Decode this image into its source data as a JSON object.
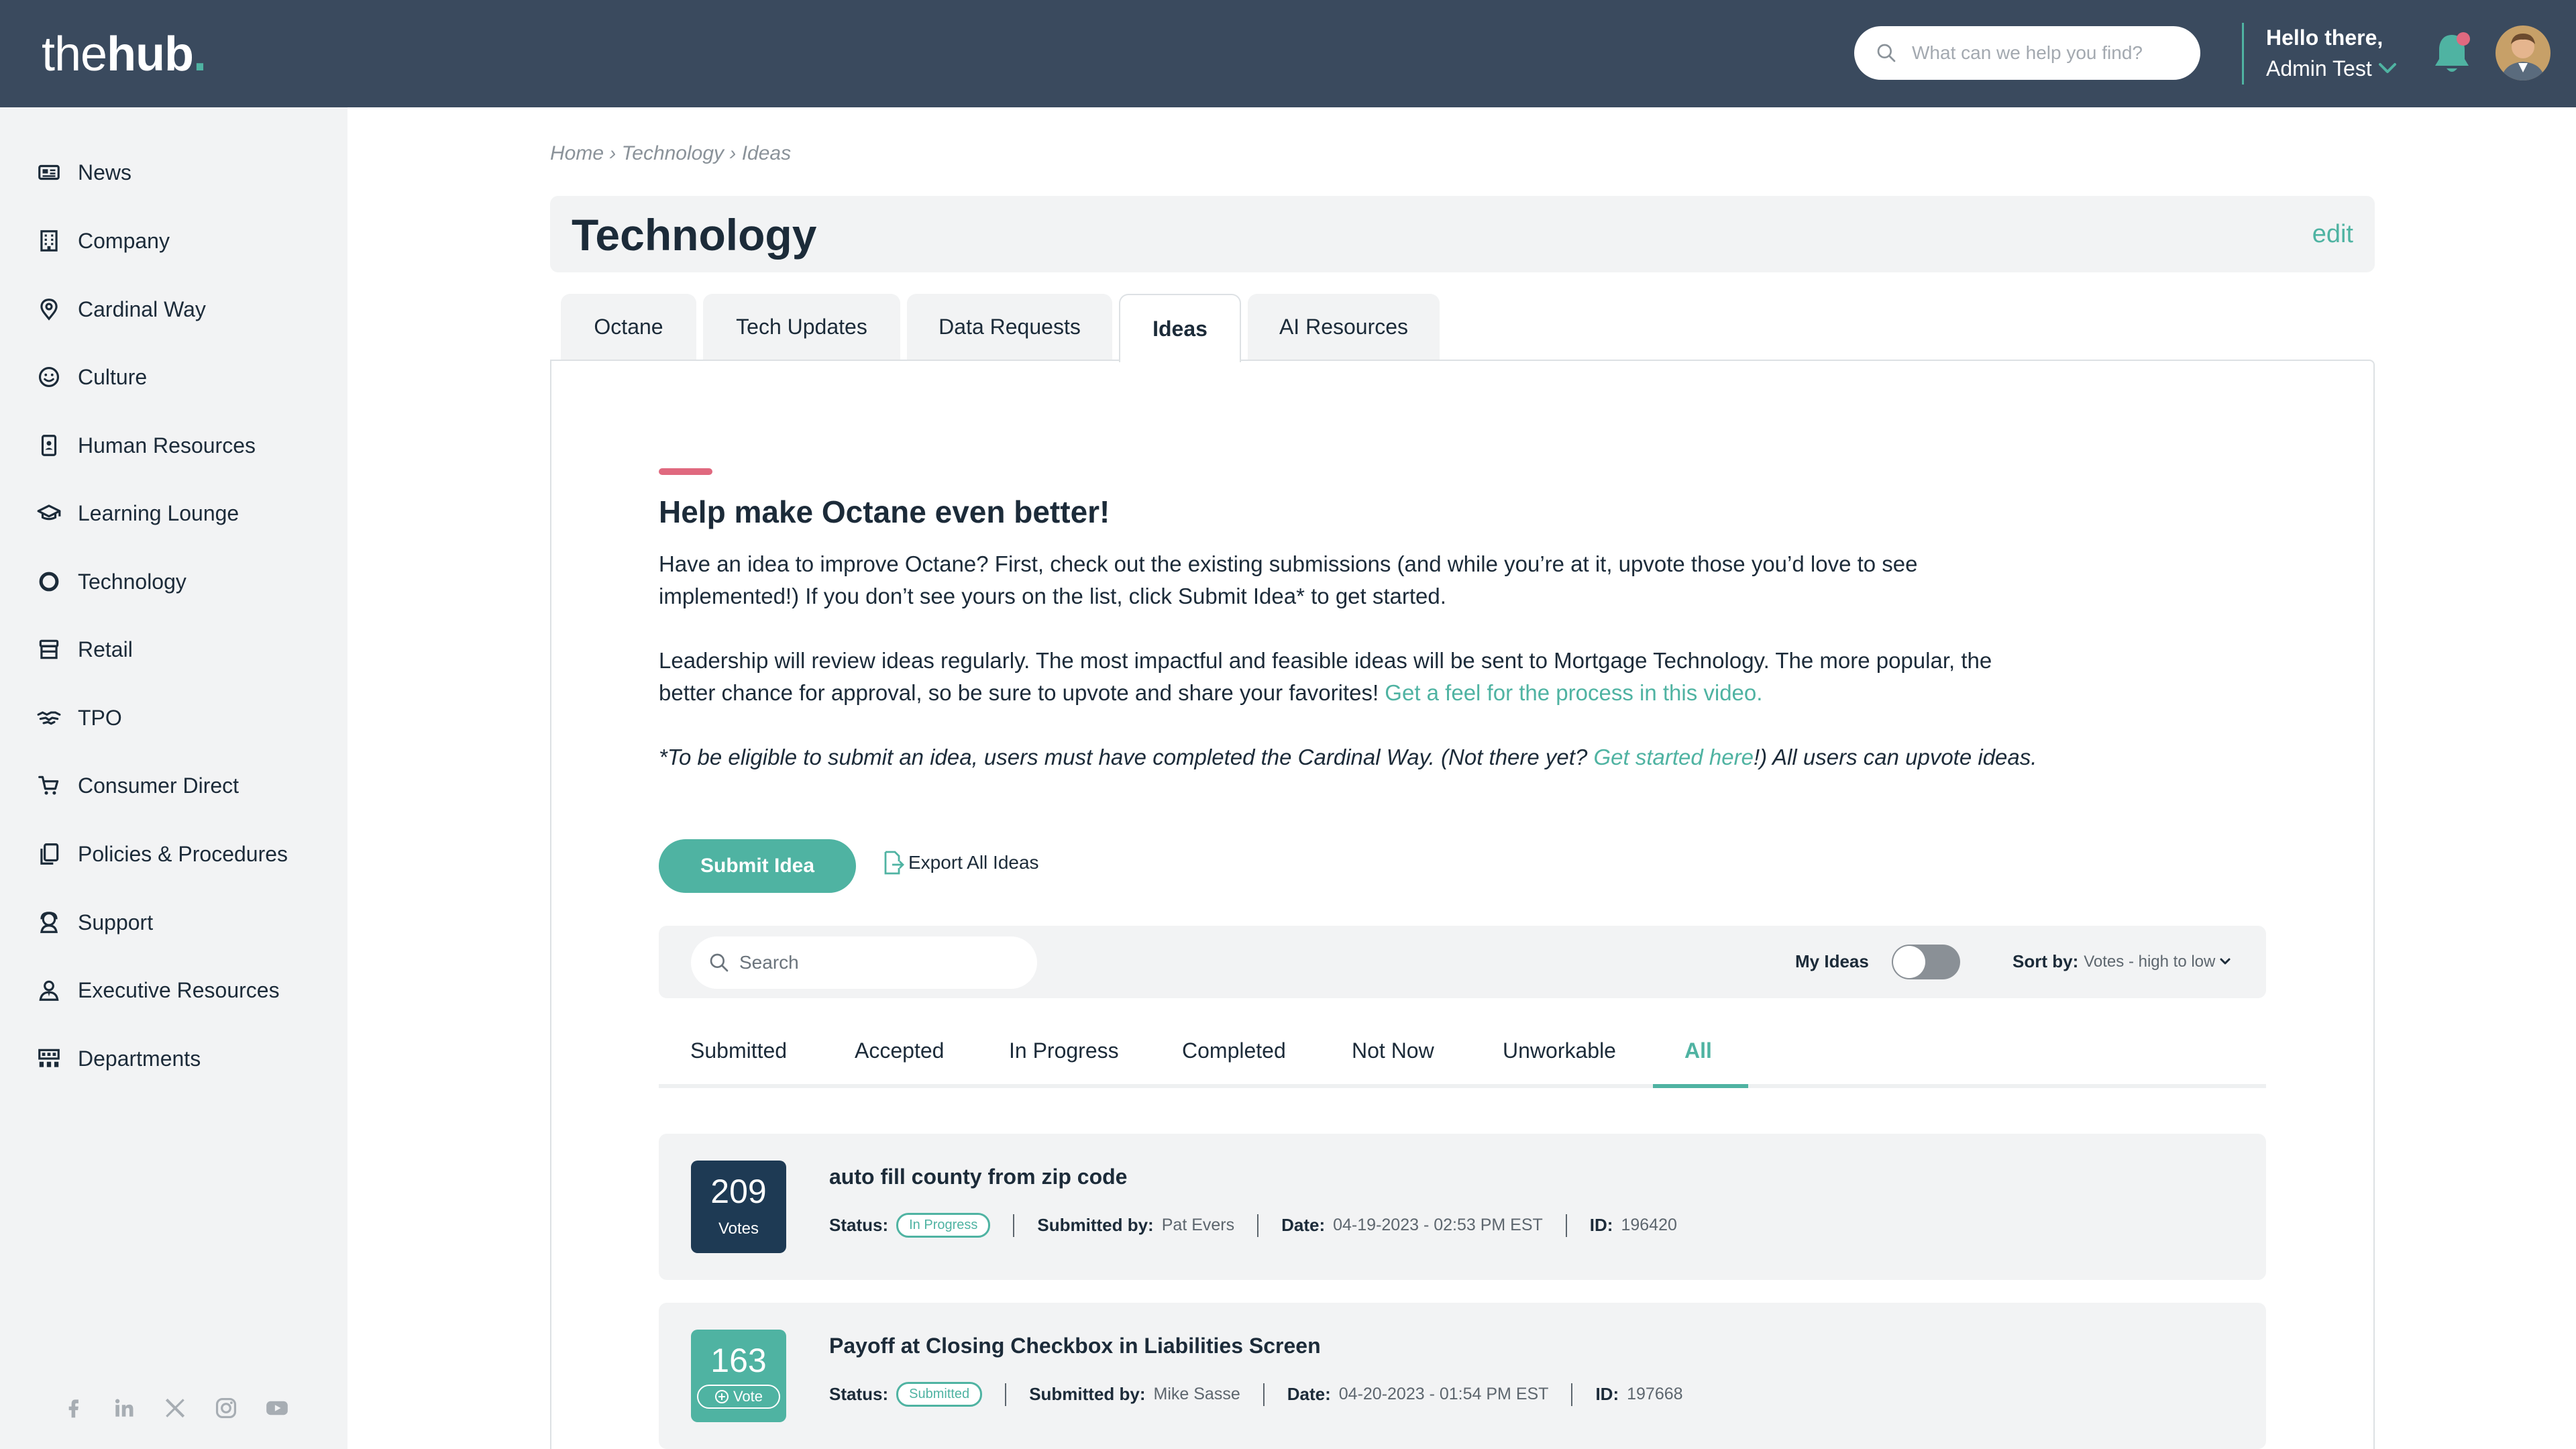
{
  "header": {
    "logo": {
      "part1": "the",
      "part2": "hub",
      "part3": "."
    },
    "search_placeholder": "What can we help you find?",
    "greeting": "Hello there,",
    "user_name": "Admin Test"
  },
  "sidebar": {
    "items": [
      {
        "label": "News",
        "icon": "newspaper-icon"
      },
      {
        "label": "Company",
        "icon": "building-icon"
      },
      {
        "label": "Cardinal Way",
        "icon": "map-pin-icon"
      },
      {
        "label": "Culture",
        "icon": "smiley-icon"
      },
      {
        "label": "Human Resources",
        "icon": "id-badge-icon"
      },
      {
        "label": "Learning Lounge",
        "icon": "graduation-cap-icon"
      },
      {
        "label": "Technology",
        "icon": "circle-icon"
      },
      {
        "label": "Retail",
        "icon": "storefront-icon"
      },
      {
        "label": "TPO",
        "icon": "handshake-icon"
      },
      {
        "label": "Consumer Direct",
        "icon": "cart-icon"
      },
      {
        "label": "Policies & Procedures",
        "icon": "documents-icon"
      },
      {
        "label": "Support",
        "icon": "support-agent-icon"
      },
      {
        "label": "Executive Resources",
        "icon": "executive-icon"
      },
      {
        "label": "Departments",
        "icon": "grid-people-icon"
      }
    ],
    "socials": [
      "facebook-icon",
      "linkedin-icon",
      "x-icon",
      "instagram-icon",
      "youtube-icon"
    ]
  },
  "breadcrumb": "Home › Technology › Ideas",
  "page": {
    "title": "Technology",
    "edit_label": "edit"
  },
  "tabs": [
    {
      "label": "Octane"
    },
    {
      "label": "Tech Updates"
    },
    {
      "label": "Data Requests"
    },
    {
      "label": "Ideas",
      "active": true
    },
    {
      "label": "AI Resources"
    }
  ],
  "intro": {
    "title": "Help make Octane even better!",
    "p1": "Have an idea to improve Octane? First, check out the existing submissions (and while you’re at it, upvote those you’d love to see implemented!) If you don’t see yours on the list, click Submit Idea* to get started.",
    "p2_text": "Leadership will review ideas regularly. The most impactful and feasible ideas will be sent to Mortgage Technology. The more popular, the better chance for approval, so be sure to upvote and share your favorites! ",
    "p2_link": "Get a feel for the process in this video.",
    "p3_pre": "*To be eligible to submit an idea, users must have completed the Cardinal Way. (Not there yet? ",
    "p3_link": "Get started here",
    "p3_post": "!) All users can upvote ideas."
  },
  "actions": {
    "submit_label": "Submit Idea",
    "export_label": "Export All Ideas"
  },
  "filters": {
    "search_placeholder": "Search",
    "my_ideas_label": "My Ideas",
    "my_ideas_on": false,
    "sort_label": "Sort by:",
    "sort_value": "Votes - high to low"
  },
  "status_tabs": [
    {
      "label": "Submitted"
    },
    {
      "label": "Accepted"
    },
    {
      "label": "In Progress"
    },
    {
      "label": "Completed"
    },
    {
      "label": "Not Now"
    },
    {
      "label": "Unworkable"
    },
    {
      "label": "All",
      "active": true
    }
  ],
  "ideas": [
    {
      "votes": "209",
      "vote_label": "Votes",
      "voted": true,
      "title": "auto fill county from zip code",
      "status_label": "Status:",
      "status": "In Progress",
      "submitted_by_label": "Submitted by:",
      "submitted_by": "Pat Evers",
      "date_label": "Date:",
      "date": "04-19-2023 - 02:53 PM EST",
      "id_label": "ID:",
      "id": "196420"
    },
    {
      "votes": "163",
      "vote_label": "Vote",
      "voted": false,
      "title": "Payoff at Closing Checkbox in Liabilities Screen",
      "status_label": "Status:",
      "status": "Submitted",
      "submitted_by_label": "Submitted by:",
      "submitted_by": "Mike Sasse",
      "date_label": "Date:",
      "date": "04-20-2023 - 01:54 PM EST",
      "id_label": "ID:",
      "id": "197668"
    }
  ],
  "colors": {
    "header_bg": "#3a4a5e",
    "accent": "#4fb3a2",
    "navy": "#1e3a54",
    "pink": "#e0697f",
    "surface": "#f2f3f4"
  }
}
